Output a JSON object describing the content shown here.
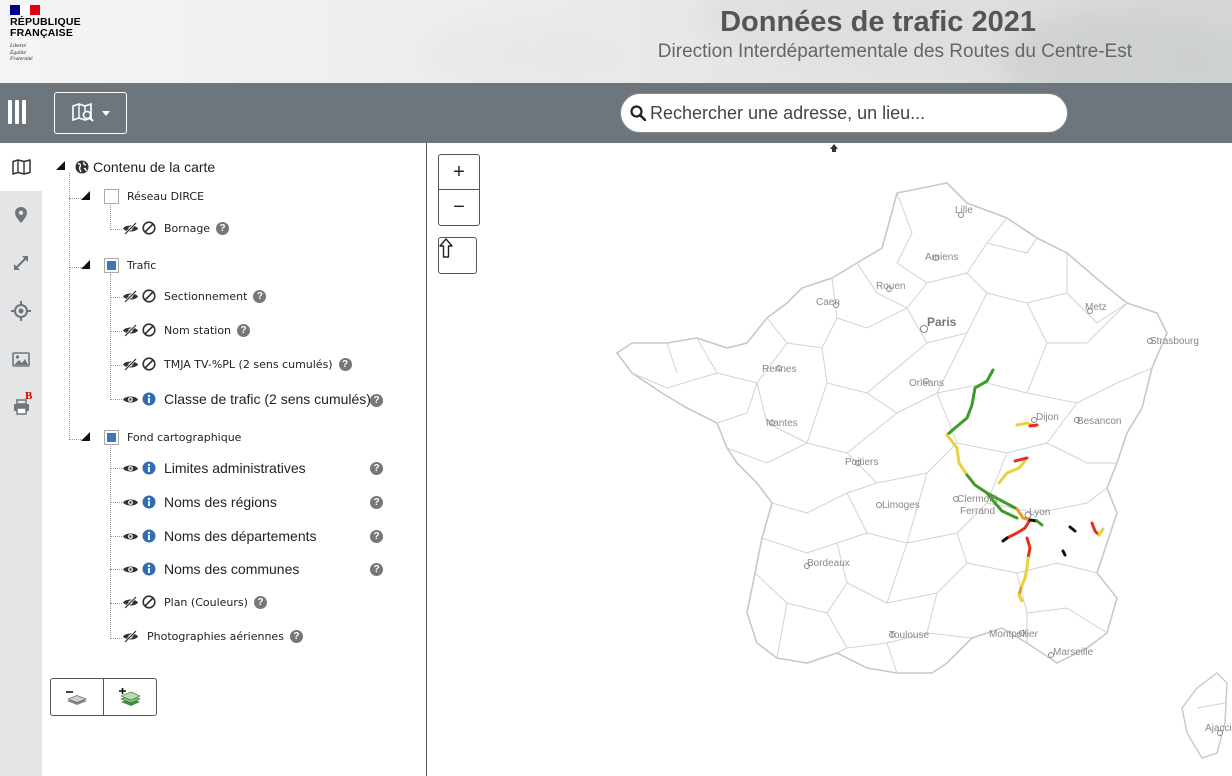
{
  "header": {
    "logo_line1": "RÉPUBLIQUE",
    "logo_line2": "FRANÇAISE",
    "motto_1": "Liberté",
    "motto_2": "Égalité",
    "motto_3": "Fraternité",
    "title": "Données de trafic 2021",
    "subtitle": "Direction Interdépartementale des Routes du Centre-Est"
  },
  "toolbar": {
    "search_placeholder": "Rechercher une adresse, un lieu..."
  },
  "tabs": [
    "map-icon",
    "location-pin-icon",
    "expand-arrows-icon",
    "crosshair-icon",
    "image-icon",
    "printer-icon"
  ],
  "tab_print_badge": "B",
  "layers": {
    "root": "Contenu de la carte",
    "group_reseau": "Réseau DIRCE",
    "bornage": "Bornage",
    "group_trafic": "Trafic",
    "sectionnement": "Sectionnement",
    "nom_station": "Nom station",
    "tmja": "TMJA TV-%PL (2 sens cumulés)",
    "classe": "Classe de trafic (2 sens cumulés)",
    "group_fond": "Fond cartographique",
    "limites": "Limites administratives",
    "regions": "Noms des régions",
    "departements": "Noms des départements",
    "communes": "Noms des communes",
    "plan": "Plan (Couleurs)",
    "photos": "Photographies aériennes"
  },
  "map": {
    "zoom_in": "+",
    "zoom_out": "−",
    "cities": {
      "lille": "Lille",
      "amiens": "Amiens",
      "rouen": "Rouen",
      "caen": "Caen",
      "paris": "Paris",
      "metz": "Metz",
      "strasbourg": "Strasbourg",
      "rennes": "Rennes",
      "orleans": "Orleans",
      "dijon": "Dijon",
      "besancon": "Besancon",
      "nantes": "Nantes",
      "poitiers": "Poitiers",
      "limoges": "Limoges",
      "clermont1": "Clermont-",
      "clermont2": "Ferrand",
      "lyon": "Lyon",
      "bordeaux": "Bordeaux",
      "toulouse": "Toulouse",
      "montpellier": "Montpellier",
      "marseille": "Marseille",
      "ajaccio": "Ajaccio"
    },
    "colors": {
      "green": "#3f9a2b",
      "yellow": "#e8d23c",
      "orange": "#f09a20",
      "red": "#e0321e",
      "black": "#111111",
      "border": "#c8c8c8"
    }
  }
}
